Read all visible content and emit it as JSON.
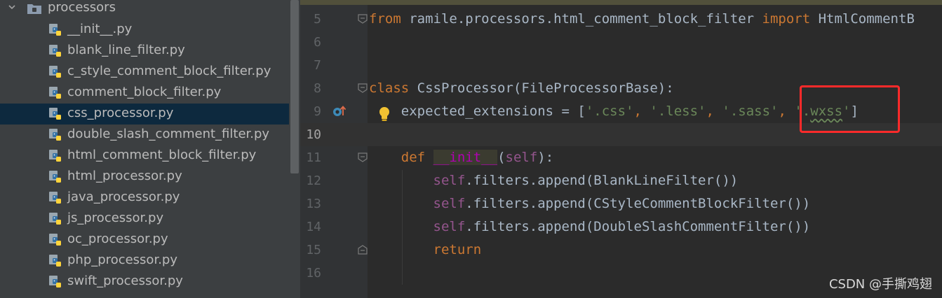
{
  "project_tree": {
    "folder": {
      "name": "processors",
      "expanded": true,
      "icon": "folder-icon"
    },
    "files": [
      {
        "name": "__init__.py",
        "icon": "python-file-icon"
      },
      {
        "name": "blank_line_filter.py",
        "icon": "python-file-icon"
      },
      {
        "name": "c_style_comment_block_filter.py",
        "icon": "python-file-icon"
      },
      {
        "name": "comment_block_filter.py",
        "icon": "python-file-icon"
      },
      {
        "name": "css_processor.py",
        "icon": "python-file-icon",
        "selected": true
      },
      {
        "name": "double_slash_comment_filter.py",
        "icon": "python-file-icon"
      },
      {
        "name": "html_comment_block_filter.py",
        "icon": "python-file-icon"
      },
      {
        "name": "html_processor.py",
        "icon": "python-file-icon"
      },
      {
        "name": "java_processor.py",
        "icon": "python-file-icon"
      },
      {
        "name": "js_processor.py",
        "icon": "python-file-icon"
      },
      {
        "name": "oc_processor.py",
        "icon": "python-file-icon"
      },
      {
        "name": "php_processor.py",
        "icon": "python-file-icon"
      },
      {
        "name": "swift_processor.py",
        "icon": "python-file-icon"
      }
    ]
  },
  "editor": {
    "current_line": 10,
    "lines": [
      {
        "n": "5",
        "text": "from ramile.processors.html_comment_block_filter import HtmlCommentB"
      },
      {
        "n": "6",
        "text": ""
      },
      {
        "n": "7",
        "text": ""
      },
      {
        "n": "8",
        "text": "class CssProcessor(FileProcessorBase):"
      },
      {
        "n": "9",
        "text": "    expected_extensions = ['.css', '.less', '.sass', '.wxss']"
      },
      {
        "n": "10",
        "text": ""
      },
      {
        "n": "11",
        "text": "    def __init__(self):"
      },
      {
        "n": "12",
        "text": "        self.filters.append(BlankLineFilter())"
      },
      {
        "n": "13",
        "text": "        self.filters.append(CStyleCommentBlockFilter())"
      },
      {
        "n": "14",
        "text": "        self.filters.append(DoubleSlashCommentFilter())"
      },
      {
        "n": "15",
        "text": "        return"
      },
      {
        "n": "16",
        "text": ""
      }
    ],
    "gutter_icons": {
      "line_9": [
        "override-method-icon",
        "intention-bulb-icon"
      ]
    },
    "highlight_box": {
      "color": "#ff2a2a",
      "around": "'.wxss'"
    }
  },
  "colors": {
    "keyword": "#cc7832",
    "string": "#6a8759",
    "self": "#94558d",
    "dunder": "#b200b2",
    "text": "#a9b7c6",
    "selection": "#0d293e"
  },
  "watermark": "CSDN @手撕鸡翅"
}
